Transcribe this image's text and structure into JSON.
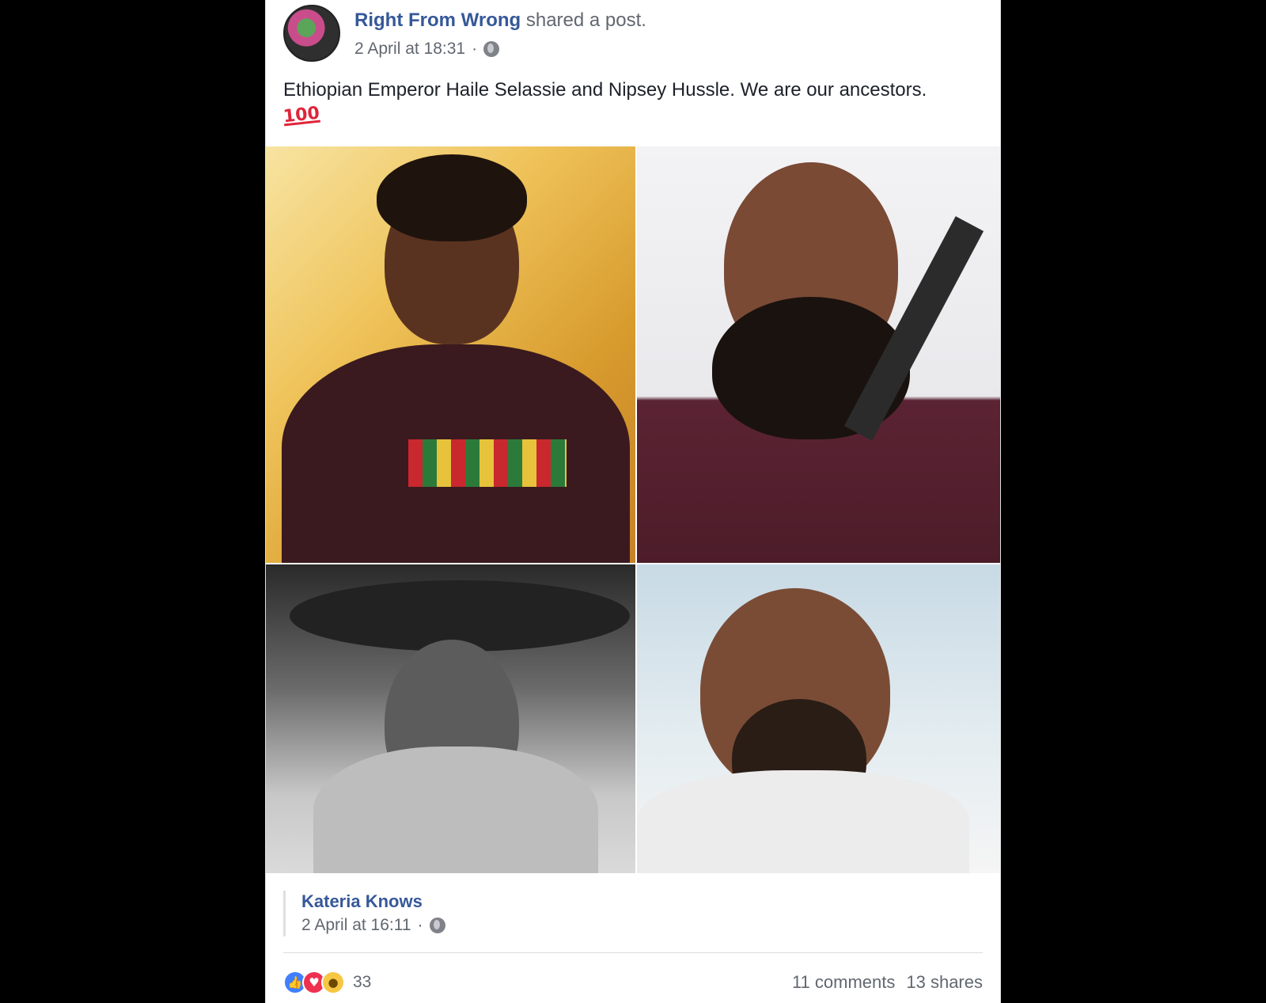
{
  "post": {
    "page_name": "Right From Wrong",
    "action_text": " shared a post.",
    "timestamp": "2 April at 18:31",
    "separator": "·",
    "text": "Ethiopian Emperor Haile Selassie and Nipsey Hussle. We are our ancestors.",
    "emoji": "100"
  },
  "shared_from": {
    "name": "Kateria Knows",
    "timestamp": "2 April at 16:11",
    "separator": "·"
  },
  "reactions": {
    "count": "33",
    "icons": [
      "like-icon",
      "love-icon",
      "wow-icon"
    ]
  },
  "stats": {
    "comments": "11 comments",
    "shares": "13 shares"
  },
  "colors": {
    "link": "#365899",
    "meta": "#616770"
  }
}
